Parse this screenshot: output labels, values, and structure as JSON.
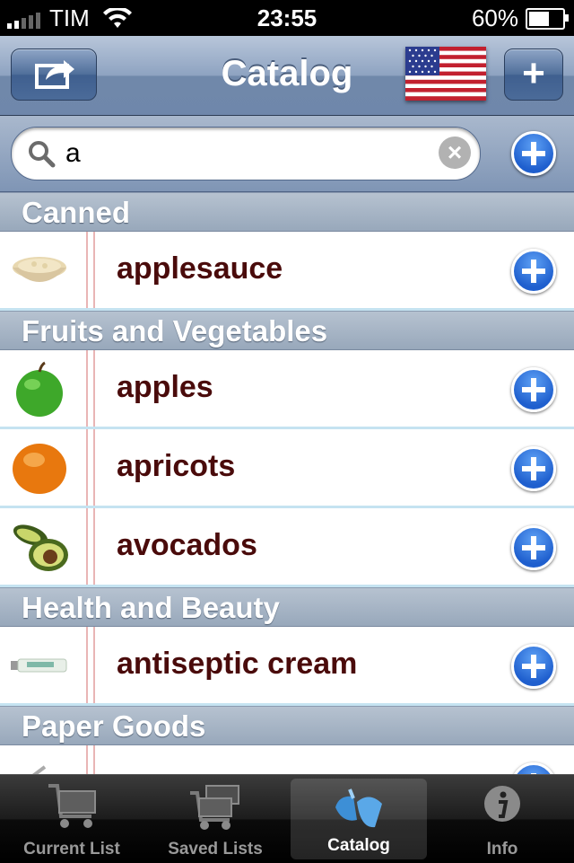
{
  "status_bar": {
    "carrier": "TIM",
    "time": "23:55",
    "battery": "60%",
    "battery_level": 0.6
  },
  "nav": {
    "title": "Catalog",
    "share_icon": "share-icon",
    "add_label": "+",
    "flag_icon": "us-flag-icon"
  },
  "search": {
    "value": "a",
    "placeholder": ""
  },
  "sections": [
    {
      "title": "Canned",
      "items": [
        {
          "name": "applesauce",
          "icon": "applesauce-bowl-icon"
        }
      ]
    },
    {
      "title": "Fruits and Vegetables",
      "items": [
        {
          "name": "apples",
          "icon": "apple-icon"
        },
        {
          "name": "apricots",
          "icon": "apricot-icon"
        },
        {
          "name": "avocados",
          "icon": "avocado-icon"
        }
      ]
    },
    {
      "title": "Health and Beauty",
      "items": [
        {
          "name": "antiseptic cream",
          "icon": "cream-tube-icon"
        }
      ]
    },
    {
      "title": "Paper Goods",
      "items": [
        {
          "name": "",
          "icon": "paper-item-icon"
        }
      ]
    }
  ],
  "tabs": [
    {
      "label": "Current List",
      "icon": "cart-icon",
      "selected": false
    },
    {
      "label": "Saved Lists",
      "icon": "carts-icon",
      "selected": false
    },
    {
      "label": "Catalog",
      "icon": "catalog-icon",
      "selected": true
    },
    {
      "label": "Info",
      "icon": "info-icon",
      "selected": false
    }
  ],
  "colors": {
    "item_text": "#4a0b0b",
    "accent_blue": "#1f5fce",
    "nav_blue": "#7088aa"
  }
}
